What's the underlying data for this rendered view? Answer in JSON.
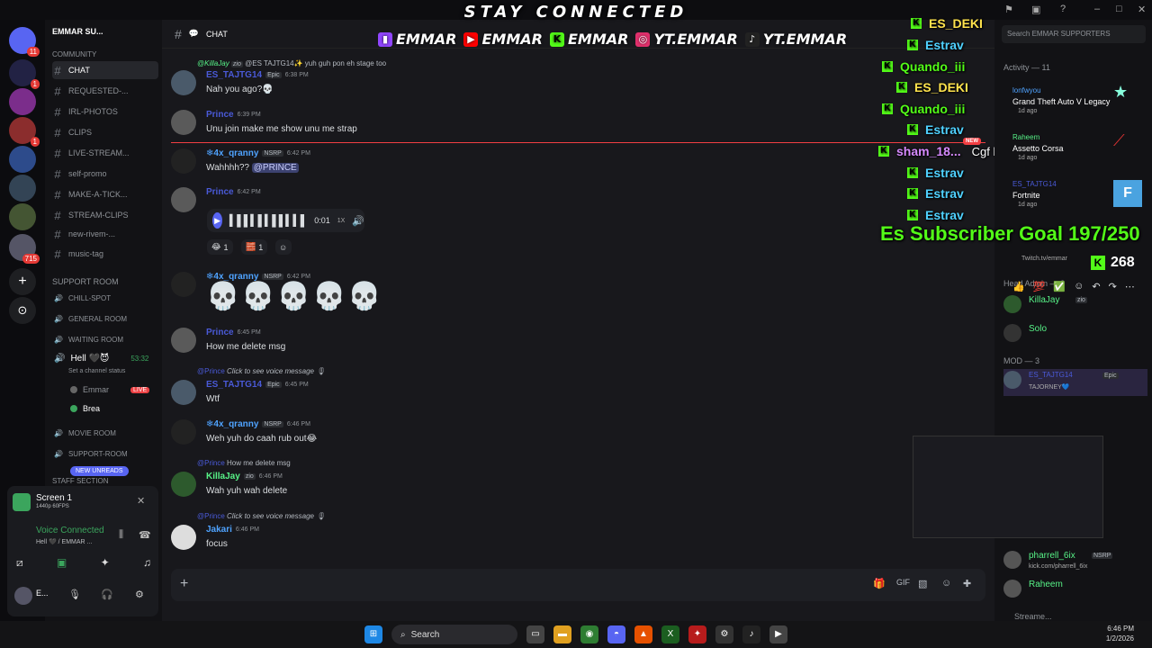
{
  "banner": {
    "title": "STAY CONNECTED",
    "socials": [
      {
        "icon": "twitch-icon",
        "label": "EMMAR",
        "color": "#9146ff"
      },
      {
        "icon": "youtube-icon",
        "label": "EMMAR",
        "color": "#ff0000"
      },
      {
        "icon": "kick-icon",
        "label": "EMMAR",
        "color": "#53fc18"
      },
      {
        "icon": "instagram-icon",
        "label": "YT.EMMAR",
        "color": "#e1306c"
      },
      {
        "icon": "tiktok-icon",
        "label": "YT.EMMAR",
        "color": "#111111"
      }
    ]
  },
  "sidebar": {
    "server_name": "EMMAR SU...",
    "community_label": "COMMUNITY",
    "channels": [
      {
        "name": "CHAT",
        "active": true
      },
      {
        "name": "REQUESTED-..."
      },
      {
        "name": "IRL-PHOTOS"
      },
      {
        "name": "CLIPS"
      },
      {
        "name": "LIVE-STREAM..."
      },
      {
        "name": "self-promo"
      },
      {
        "name": "MAKE-A-TICK..."
      },
      {
        "name": "STREAM-CLIPS"
      },
      {
        "name": "new-rivem-..."
      },
      {
        "name": "music-tag"
      }
    ],
    "support_room": "SUPPORT ROOM",
    "voice_channels": [
      "CHILL-SPOT",
      "GENERAL ROOM",
      "WAITING ROOM"
    ],
    "active_voice": {
      "name": "Hell 🖤😈",
      "timer": "53:32",
      "status_placeholder": "Set a channel status",
      "users": [
        {
          "name": "Emmar",
          "live": "LIVE"
        },
        {
          "name": "Brea"
        }
      ]
    },
    "more_voice": [
      "MOVIE ROOM",
      "SUPPORT-ROOM"
    ],
    "staff_section": "STAFF SECTION",
    "new_unreads": "NEW UNREADS"
  },
  "userbar": {
    "screen_title": "Screen 1",
    "screen_sub": "1440p 60FPS",
    "voice_connected": "Voice Connected",
    "voice_sub": "Hell 🖤 / EMMAR ...",
    "username": "E..."
  },
  "chat": {
    "channel_title": "CHAT",
    "messages": [
      {
        "reply_user": "@KillaJay",
        "reply_tag": "zio",
        "reply_text": "@ES TAJTG14✨ yuh guh pon eh stage too",
        "user": "ES_TAJTG14",
        "time": "6:38 PM",
        "text": "Nah you ago?💀"
      },
      {
        "user": "Prince",
        "time": "6:39 PM",
        "text": "Unu join make me show unu me strap"
      },
      {
        "user": "❄4x_qranny",
        "tag": "NSRP",
        "time": "6:42 PM",
        "text": "Wahhhh??",
        "mention": "@PRINCE"
      },
      {
        "user": "Prince",
        "time": "6:42 PM",
        "voice_time": "0:01",
        "speed": "1X",
        "reactions": [
          {
            "emoji": "😂",
            "count": "1"
          },
          {
            "emoji": "🧱",
            "count": "1"
          }
        ]
      },
      {
        "user": "❄4x_qranny",
        "tag": "NSRP",
        "time": "6:42 PM",
        "text": "💀💀💀💀💀"
      },
      {
        "user": "Prince",
        "time": "6:45 PM",
        "text": "How me delete msg"
      },
      {
        "reply_user": "@Prince",
        "reply_text": "Click to see voice message",
        "user": "ES_TAJTG14",
        "tag": "Epic",
        "time": "6:45 PM",
        "text": "Wtf"
      },
      {
        "user": "❄4x_qranny",
        "tag": "NSRP",
        "time": "6:46 PM",
        "text": "Weh yuh do caah rub out😂"
      },
      {
        "reply_user": "@Prince",
        "reply_text": "How me delete msg",
        "user": "KillaJay",
        "tag": "zio",
        "time": "6:46 PM",
        "text": "Wah yuh wah delete"
      },
      {
        "reply_user": "@Prince",
        "reply_text": "Click to see voice message",
        "user": "Jakari",
        "time": "6:46 PM",
        "text": "focus"
      }
    ],
    "new_marker": "NEW",
    "epic_tag": "Epic"
  },
  "kick_overlay": [
    {
      "name": "ES_DEKI",
      "color": "#ffe34d"
    },
    {
      "name": "Estrav",
      "color": "#4fd1ff"
    },
    {
      "name": "Quando_iii",
      "color": "#53fc18"
    },
    {
      "name": "ES_DEKI",
      "color": "#ffe34d"
    },
    {
      "name": "Quando_iii",
      "color": "#53fc18"
    },
    {
      "name": "Estrav",
      "color": "#4fd1ff"
    },
    {
      "name": "sham_18...",
      "color": "#d68aff"
    },
    {
      "name": "Estrav",
      "color": "#4fd1ff"
    },
    {
      "name": "Estrav",
      "color": "#4fd1ff"
    },
    {
      "name": "Estrav",
      "color": "#4fd1ff"
    }
  ],
  "overlay_extra": "Cgf k",
  "goal": {
    "text": "Es Subscriber Goal 197/250",
    "count": "268"
  },
  "members": {
    "search_placeholder": "Search EMMAR SUPPORTERS",
    "activity_label": "Activity — 11",
    "activities": [
      {
        "user": "lonfwyou",
        "game": "Grand Theft Auto V Legacy",
        "time": "1d ago"
      },
      {
        "user": "Raheem",
        "game": "Assetto Corsa",
        "time": "1d ago"
      },
      {
        "user": "ES_TAJTG14",
        "game": "Fortnite",
        "time": "1d ago"
      }
    ],
    "twitch_sub": "Twitch.tv/emmar",
    "head_admin": "Head Admin — 2",
    "admins": [
      {
        "name": "KillaJay",
        "tag": "zio"
      },
      {
        "name": "Solo"
      }
    ],
    "mod_label": "MOD — 3",
    "mods": [
      {
        "name": "ES_TAJTG14",
        "tag": "Epic",
        "status": "TAJORNEY💙"
      }
    ],
    "others": [
      {
        "name": "pharrell_6ix",
        "tag": "NSRP",
        "status": "kick.com/pharrell_6ix"
      },
      {
        "name": "Raheem"
      }
    ],
    "streamer_label": "Streame..."
  },
  "taskbar": {
    "search": "Search",
    "time": "6:46 PM",
    "date": "1/2/2026"
  }
}
